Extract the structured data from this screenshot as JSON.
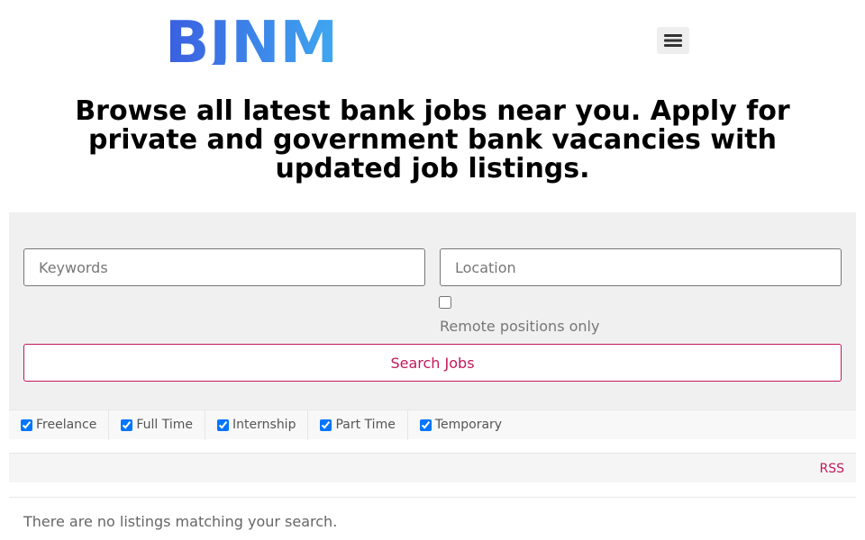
{
  "brand": {
    "logo_text": "BJNM",
    "logo_colors": [
      "#3a6fe8",
      "#3fa8f0"
    ]
  },
  "header": {
    "menu_icon": "hamburger-menu-icon"
  },
  "headline": "Browse all latest bank jobs near you. Apply for private and government bank vacancies with updated job listings.",
  "search": {
    "keywords_placeholder": "Keywords",
    "location_placeholder": "Location",
    "remote_label": "Remote positions only",
    "remote_checked": false,
    "submit_label": "Search Jobs"
  },
  "filters": [
    {
      "label": "Freelance",
      "checked": true
    },
    {
      "label": "Full Time",
      "checked": true
    },
    {
      "label": "Internship",
      "checked": true
    },
    {
      "label": "Part Time",
      "checked": true
    },
    {
      "label": "Temporary",
      "checked": true
    }
  ],
  "rss_label": "RSS",
  "no_results_text": "There are no listings matching your search.",
  "colors": {
    "accent": "#c2185b",
    "panel_bg": "#f0f0f0"
  }
}
